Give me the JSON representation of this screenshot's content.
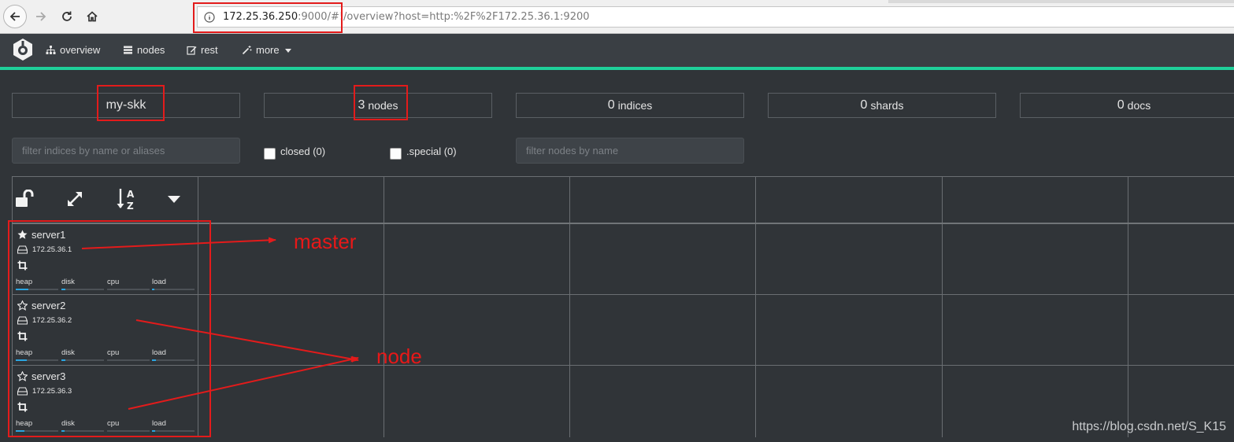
{
  "browser": {
    "url_host": "172.25.36.250",
    "url_rest": ":9000/#!/overview?host=http:%2F%2F172.25.36.1:9200"
  },
  "nav": {
    "items": [
      {
        "label": "overview",
        "icon": "sitemap-icon"
      },
      {
        "label": "nodes",
        "icon": "server-icon"
      },
      {
        "label": "rest",
        "icon": "edit-icon"
      },
      {
        "label": "more",
        "icon": "magic-wand-icon"
      }
    ]
  },
  "stats": {
    "cluster_name": "my-skk",
    "nodes": {
      "value": "3",
      "label": "nodes"
    },
    "indices": {
      "value": "0",
      "label": "indices"
    },
    "shards": {
      "value": "0",
      "label": "shards"
    },
    "docs": {
      "value": "0",
      "label": "docs"
    }
  },
  "filters": {
    "indices_placeholder": "filter indices by name or aliases",
    "closed_label": "closed (0)",
    "special_label": ".special (0)",
    "nodes_placeholder": "filter nodes by name"
  },
  "metric_labels": [
    "heap",
    "disk",
    "cpu",
    "load"
  ],
  "nodes": [
    {
      "name": "server1",
      "ip": "172.25.36.1",
      "master": true,
      "metrics": [
        0.3,
        0.1,
        0.0,
        0.05
      ]
    },
    {
      "name": "server2",
      "ip": "172.25.36.2",
      "master": false,
      "metrics": [
        0.25,
        0.1,
        0.0,
        0.1
      ]
    },
    {
      "name": "server3",
      "ip": "172.25.36.3",
      "master": false,
      "metrics": [
        0.2,
        0.08,
        0.0,
        0.08
      ]
    }
  ],
  "annotations": {
    "master": "master",
    "node": "node",
    "color": "#e31b1b"
  },
  "watermark": "https://blog.csdn.net/S_K15"
}
